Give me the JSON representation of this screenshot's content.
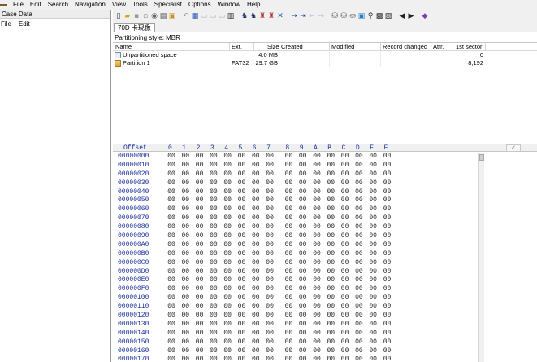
{
  "menubar": {
    "items": [
      "File",
      "Edit",
      "Search",
      "Navigation",
      "View",
      "Tools",
      "Specialist",
      "Options",
      "Window",
      "Help"
    ]
  },
  "case_pane": {
    "title": "Case Data",
    "menus": [
      "File",
      "Edit"
    ]
  },
  "toolbar": {
    "icons": [
      "new-file-icon",
      "open-icon",
      "save-icon",
      "save-as-icon",
      "properties-icon",
      "print-icon",
      "clipboard-icon",
      "undo-icon",
      "copy-block-icon",
      "cut-icon",
      "paste-icon",
      "paste-special-icon",
      "hex-icon",
      "find-text-icon",
      "find-hex-icon",
      "replace-icon",
      "find-next-icon",
      "goto-icon",
      "goto-offset-icon",
      "goto-sector-icon",
      "back-icon",
      "forward-icon",
      "disk-open-icon",
      "disk-image-icon",
      "disk-clone-icon",
      "disk-edit-icon",
      "search-disk-icon",
      "ram-icon",
      "process-icon",
      "prev-icon",
      "next-icon",
      "tag-icon"
    ]
  },
  "tab": {
    "label": "70D 卡现像"
  },
  "partition_style": "Partitioning style: MBR",
  "file_table": {
    "columns": [
      "Name",
      "Ext.",
      "Size",
      "Created",
      "Modified",
      "Record changed",
      "Attr.",
      "1st sector"
    ],
    "rows": [
      {
        "name": "Unpartitioned space",
        "ext": "",
        "size": "4.0 MB",
        "created": "",
        "modified": "",
        "record_changed": "",
        "attr": "",
        "first_sector": "0",
        "icon": "unpartitioned-space-icon"
      },
      {
        "name": "Partition 1",
        "ext": "FAT32",
        "size": "29.7 GB",
        "created": "",
        "modified": "",
        "record_changed": "",
        "attr": "",
        "first_sector": "8,192",
        "icon": "partition-icon"
      }
    ]
  },
  "hex_view": {
    "offset_label": "Offset",
    "columns": [
      "0",
      "1",
      "2",
      "3",
      "4",
      "5",
      "6",
      "7",
      "8",
      "9",
      "A",
      "B",
      "C",
      "D",
      "E",
      "F"
    ],
    "ascii_toggle": "✓",
    "byte_value": "00",
    "offsets": [
      "00000000",
      "00000010",
      "00000020",
      "00000030",
      "00000040",
      "00000050",
      "00000060",
      "00000070",
      "00000080",
      "00000090",
      "000000A0",
      "000000B0",
      "000000C0",
      "000000D0",
      "000000E0",
      "000000F0",
      "00000100",
      "00000110",
      "00000120",
      "00000130",
      "00000140",
      "00000150",
      "00000160",
      "00000170"
    ]
  },
  "colors": {
    "offset_blue": "#1a2f9c",
    "chrome_gray": "#f0f0f0"
  }
}
